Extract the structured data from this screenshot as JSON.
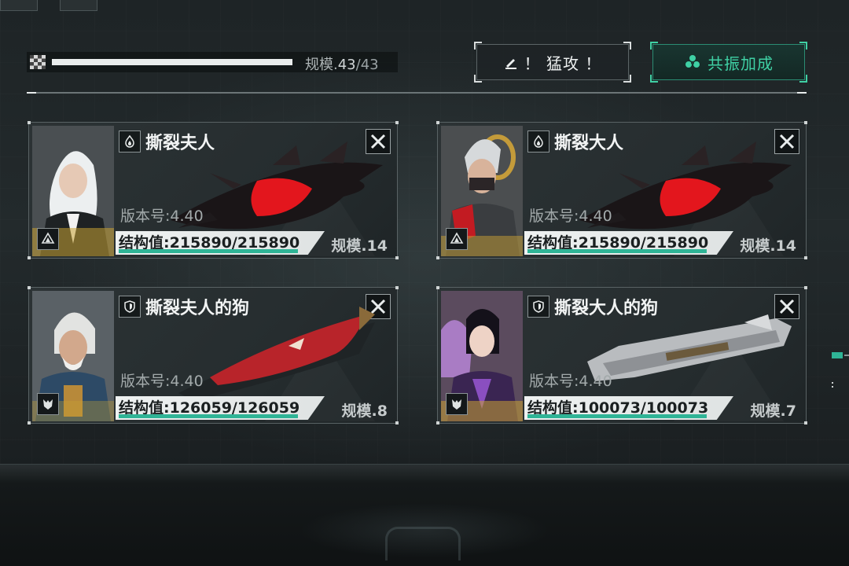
{
  "header": {
    "scale_prefix": "规模.",
    "scale_current": "43",
    "scale_max": "/43",
    "scale_progress": 1.0
  },
  "buttons": {
    "assault": "！ 猛攻 ！",
    "resonance": "共振加成"
  },
  "cards": [
    {
      "name": "撕裂夫人",
      "version": "版本号:4.40",
      "structure": "结构值:215890/215890",
      "structure_fraction": 1.0,
      "scale": "规模.14",
      "class_icon": "flame-icon",
      "rank_icon": "rank-triangle-icon"
    },
    {
      "name": "撕裂大人",
      "version": "版本号:4.40",
      "structure": "结构值:215890/215890",
      "structure_fraction": 1.0,
      "scale": "规模.14",
      "class_icon": "flame-icon",
      "rank_icon": "rank-triangle-icon"
    },
    {
      "name": "撕裂夫人的狗",
      "version": "版本号:4.40",
      "structure": "结构值:126059/126059",
      "structure_fraction": 1.0,
      "scale": "规模.8",
      "class_icon": "shield-icon",
      "rank_icon": "wolf-icon"
    },
    {
      "name": "撕裂大人的狗",
      "version": "版本号:4.40",
      "structure": "结构值:100073/100073",
      "structure_fraction": 1.0,
      "scale": "规模.7",
      "class_icon": "shield-icon",
      "rank_icon": "wolf-icon"
    }
  ],
  "colors": {
    "accent_green": "#3fd0a4",
    "structure_bar": "#2fb496",
    "portrait_gold": "#c9a233"
  }
}
